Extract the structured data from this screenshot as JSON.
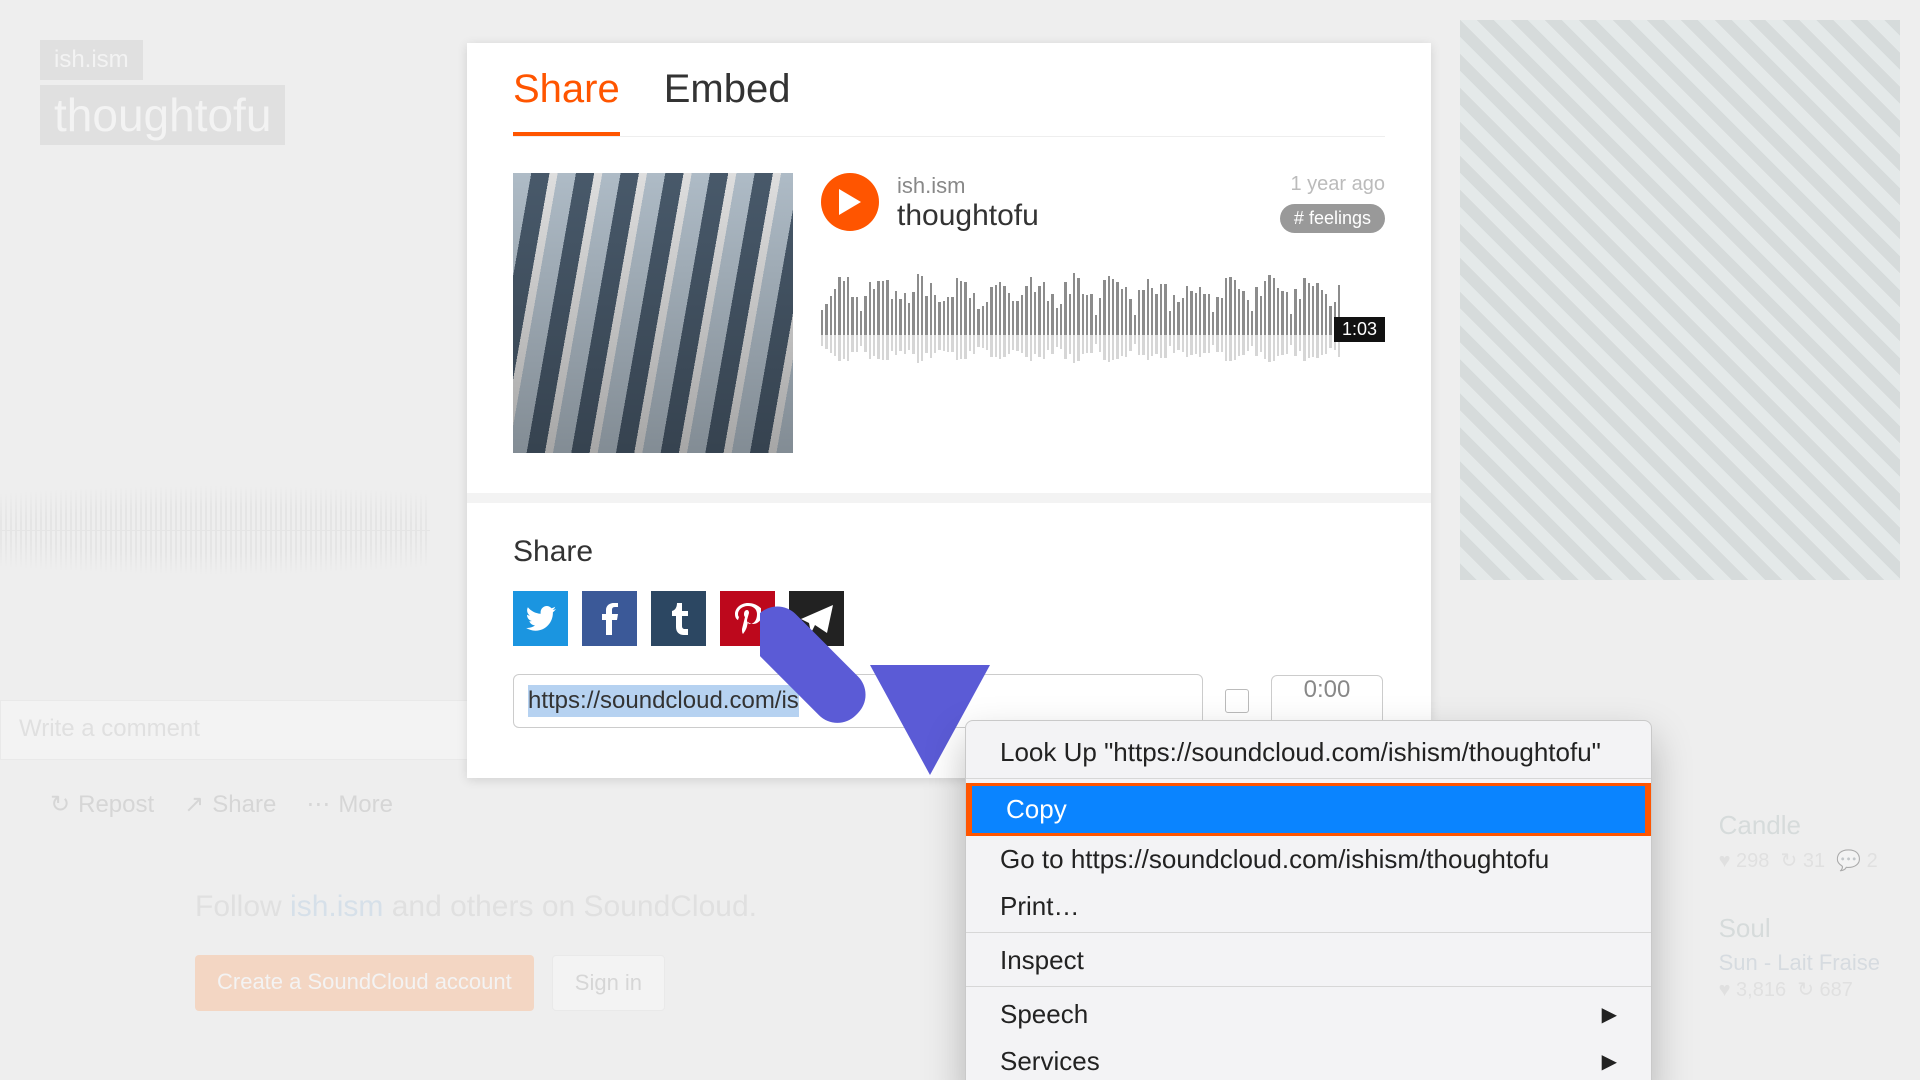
{
  "backdrop": {
    "artist_pill": "ish.ism",
    "title_pill": "thoughtofu",
    "comment_placeholder": "Write a comment",
    "toolbar": {
      "repost": "Repost",
      "share": "Share",
      "more": "More"
    },
    "follow_pre": "Follow ",
    "follow_link": "ish.ism",
    "follow_post": " and others on SoundCloud.",
    "create_btn": "Create a SoundCloud account",
    "signin_btn": "Sign in",
    "related": [
      {
        "title": "Candle",
        "likes": "298",
        "reposts": "31",
        "comments": "2"
      },
      {
        "title": "Soul",
        "sub": "Sun - Lait Fraise",
        "likes": "3,816",
        "reposts": "687",
        "comments": ""
      }
    ]
  },
  "dialog": {
    "tabs": {
      "share": "Share",
      "embed": "Embed"
    },
    "track": {
      "artist": "ish.ism",
      "title": "thoughtofu",
      "ago": "1 year ago",
      "tag_hash": "#",
      "tag": "feelings",
      "duration": "1:03"
    },
    "share_heading": "Share",
    "url": "https://soundcloud.com/ishism/thoughtofu",
    "url_display": "https://soundcloud.com/is",
    "start_at": "0:00"
  },
  "context_menu": {
    "lookup": "Look Up \"https://soundcloud.com/ishism/thoughtofu\"",
    "copy": "Copy",
    "goto": "Go to https://soundcloud.com/ishism/thoughtofu",
    "print": "Print…",
    "inspect": "Inspect",
    "speech": "Speech",
    "services": "Services"
  }
}
